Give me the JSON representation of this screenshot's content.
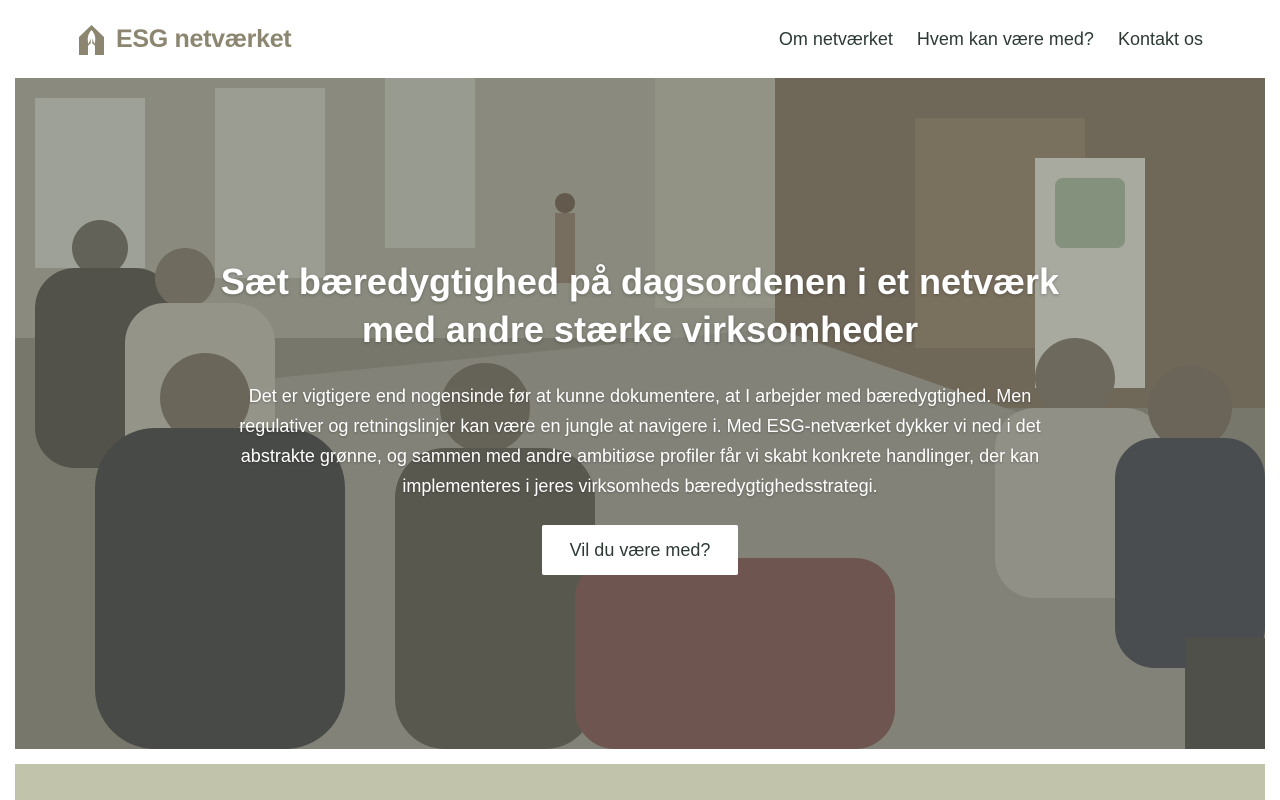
{
  "header": {
    "logo_text": "ESG netværket",
    "nav": [
      {
        "label": "Om netværket"
      },
      {
        "label": "Hvem kan være med?"
      },
      {
        "label": "Kontakt os"
      }
    ]
  },
  "hero": {
    "title": "Sæt bæredygtighed på dagsordenen i et netværk med andre stærke virksomheder",
    "text": "Det er vigtigere end nogensinde før at kunne dokumentere, at I arbejder med bæredygtighed. Men regulativer og retningslinjer kan være en jungle at navigere i. Med ESG-netværket dykker vi ned i det abstrakte grønne, og sammen med andre ambitiøse profiler får vi skabt konkrete handlinger, der kan implementeres i jeres virksomheds bæredygtighedsstrategi.",
    "cta_label": "Vil du være med?"
  },
  "colors": {
    "logo": "#8c8670",
    "text_dark": "#2c3a33",
    "section_green": "#c1c4aa"
  },
  "icons": {
    "logo": "esg-leaf-house-icon"
  }
}
